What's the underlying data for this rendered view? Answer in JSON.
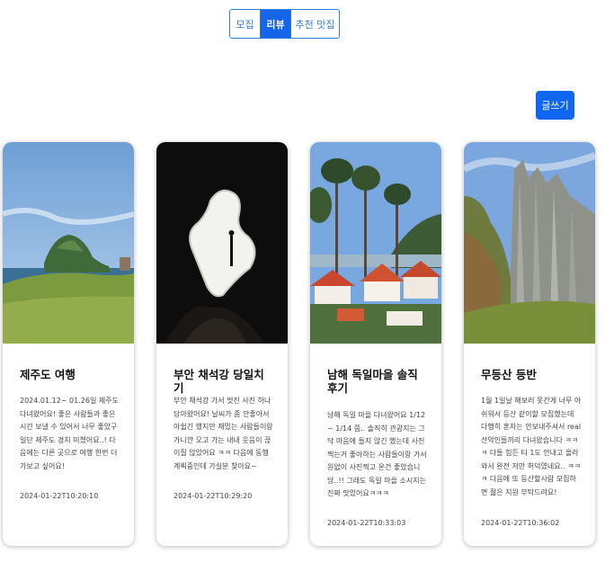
{
  "tabs": [
    {
      "label": "모집",
      "active": false
    },
    {
      "label": "리뷰",
      "active": true
    },
    {
      "label": "추천 맛집",
      "active": false
    }
  ],
  "write_button": "글쓰기",
  "cards": [
    {
      "title": "제주도 여행",
      "excerpt": "2024.01.12~ 01.26일 제주도 다녀왔어요! 좋은 사람들과 좋은 시간 보낼 수 있어서 너무 좋았구 일단 제주도 경치 미쳤어요..! 다음에는 다른 곳으로 여행 한번 더 가보고 싶어요!",
      "date": "2024-01-22T10:20:10",
      "image": "jeju-coast-hill"
    },
    {
      "title": "부안 채석강 당일치기",
      "excerpt": "부안 채석강 가서 멋진 사진 하나 담아왔어요! 날씨가 좀 안좋아서 아쉽긴 했지만 재밌는 사람들이랑 가니깐 오고 가는 내내 웃음이 끊이질 않았어요 ㅋㅋ 다음에 동행 계획중인데 가실분 찾아요~",
      "date": "2024-01-22T10:29:20",
      "image": "sea-cave-silhouette"
    },
    {
      "title": "남해 독일마을 솔직후기",
      "excerpt": "남해 독일 마을 다녀왔어요 1/12 ~ 1/14 쯤.. 솔직히 관광지는 그닥 마음에 들지 않긴 했는데 사진찍는거 좋아하는 사람들이랑 가서 원없이 사진찍고 온건 좋았습니당..!! 그래도 독일 마을 소시지는 진짜 맛있어요ㅋㅋㅋ",
      "date": "2024-01-22T10:33:03",
      "image": "german-village-pines"
    },
    {
      "title": "무등산 등반",
      "excerpt": "1월 1일날 해보러 못간게 너무 아쉬워서 등산 같이할 모집했는데 다행히 혼자는 안보내주셔서 real 산악인들끼리 다녀왔습니다 ㅋㅋㅋ 다들 힘든 티 1도 안내고 올라와서 완전 저만 허덕였네요.. ㅋㅋㅋ 다음에 또 등산할사람 모집하면 젊은 지원 부탁드려요!",
      "date": "2024-01-22T10:36:02",
      "image": "rock-pillar-cliff"
    }
  ]
}
